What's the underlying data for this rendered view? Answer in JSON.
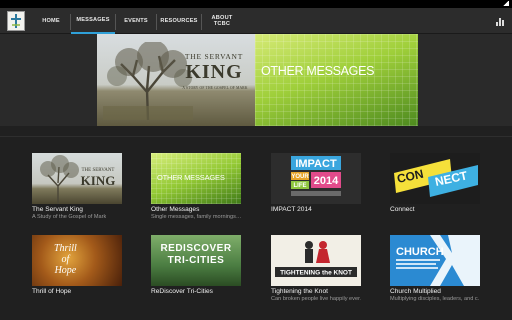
{
  "nav": {
    "tabs": [
      {
        "label": "HOME",
        "active": false
      },
      {
        "label": "MESSAGES",
        "active": true
      },
      {
        "label": "EVENTS",
        "active": false
      },
      {
        "label": "RESOURCES",
        "active": false
      },
      {
        "label": "ABOUT\nTCBC",
        "active": false
      }
    ],
    "accent_color": "#2fa0d8"
  },
  "hero": {
    "left_banner": {
      "title_line1": "THE SERVANT",
      "title_line2": "KING",
      "subtitle": "A STORY OF THE GOSPEL OF MARK"
    },
    "right_banner": {
      "title": "OTHER MESSAGES"
    }
  },
  "series": [
    {
      "title": "The Servant King",
      "subtitle": "A Study of the Gospel of Mark",
      "thumb": "servant",
      "thumb_text": "THE SERVANT KING"
    },
    {
      "title": "Other Messages",
      "subtitle": "Single messages, family mornings…",
      "thumb": "other",
      "thumb_text": "OTHER MESSAGES"
    },
    {
      "title": "IMPACT 2014",
      "subtitle": "",
      "thumb": "impact",
      "thumb_text": "IMPACT YOUR LIFE 2014"
    },
    {
      "title": "Connect",
      "subtitle": "",
      "thumb": "connect",
      "thumb_text": "CONNECT"
    },
    {
      "title": "Thrill of Hope",
      "subtitle": "",
      "thumb": "thrill",
      "thumb_text": "Thrill of Hope"
    },
    {
      "title": "ReDiscover Tri-Cities",
      "subtitle": "",
      "thumb": "rediscover",
      "thumb_text": "REDISCOVER TRI-CITIES"
    },
    {
      "title": "Tightening the Knot",
      "subtitle": "Can broken people live happily ever…",
      "thumb": "knot",
      "thumb_text": "TIGHTENING the KNOT"
    },
    {
      "title": "Church Multiplied",
      "subtitle": "Multiplying disciples, leaders, and c…",
      "thumb": "church",
      "thumb_text": "CHURCH"
    }
  ]
}
